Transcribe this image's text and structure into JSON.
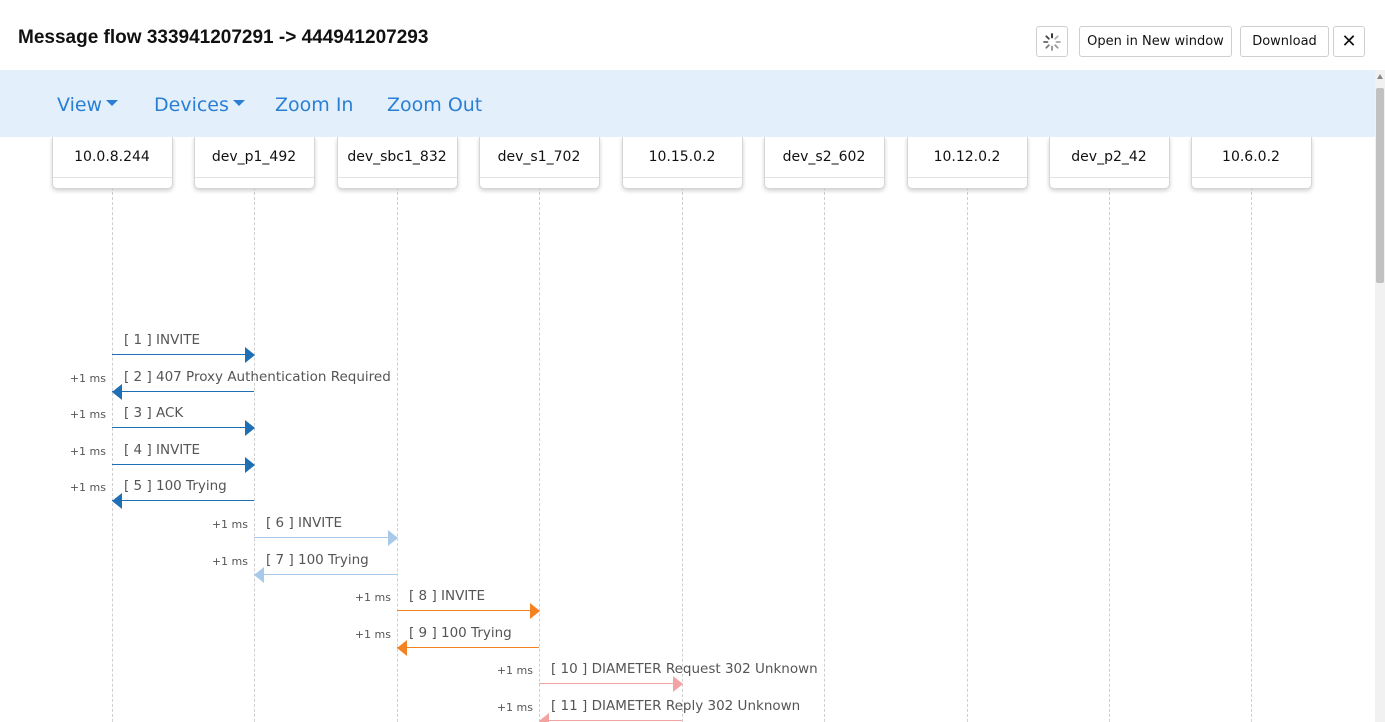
{
  "header": {
    "title": "Message flow 333941207291 -> 444941207293",
    "open_label": "Open in New window",
    "download_label": "Download",
    "close_glyph": "✕",
    "spinner_icon": "loading-spinner-icon"
  },
  "nav": {
    "view_label": "View",
    "devices_label": "Devices",
    "zoom_in_label": "Zoom In",
    "zoom_out_label": "Zoom Out"
  },
  "devices": [
    "10.0.8.244",
    "dev_p1_492",
    "dev_sbc1_832",
    "dev_s1_702",
    "10.15.0.2",
    "dev_s2_602",
    "10.12.0.2",
    "dev_p2_42",
    "10.6.0.2"
  ],
  "colors": {
    "dark_blue": "#1f6fb4",
    "light_blue": "#a9c9ea",
    "orange": "#f58220",
    "pink": "#f4a3a3",
    "link": "#2a7fd4",
    "nav_bg": "#e3f0fb"
  },
  "messages": [
    {
      "label": "[ 1 ] INVITE",
      "delta": "",
      "from": 0,
      "to": 1,
      "color": "dark_blue"
    },
    {
      "label": "[ 2 ] 407 Proxy Authentication Required",
      "delta": "+1 ms",
      "from": 1,
      "to": 0,
      "color": "dark_blue"
    },
    {
      "label": "[ 3 ] ACK",
      "delta": "+1 ms",
      "from": 0,
      "to": 1,
      "color": "dark_blue"
    },
    {
      "label": "[ 4 ] INVITE",
      "delta": "+1 ms",
      "from": 0,
      "to": 1,
      "color": "dark_blue"
    },
    {
      "label": "[ 5 ] 100 Trying",
      "delta": "+1 ms",
      "from": 1,
      "to": 0,
      "color": "dark_blue"
    },
    {
      "label": "[ 6 ] INVITE",
      "delta": "+1 ms",
      "from": 1,
      "to": 2,
      "color": "light_blue"
    },
    {
      "label": "[ 7 ] 100 Trying",
      "delta": "+1 ms",
      "from": 2,
      "to": 1,
      "color": "light_blue"
    },
    {
      "label": "[ 8 ] INVITE",
      "delta": "+1 ms",
      "from": 2,
      "to": 3,
      "color": "orange"
    },
    {
      "label": "[ 9 ] 100 Trying",
      "delta": "+1 ms",
      "from": 3,
      "to": 2,
      "color": "orange"
    },
    {
      "label": "[ 10 ] DIAMETER Request 302 Unknown",
      "delta": "+1 ms",
      "from": 3,
      "to": 4,
      "color": "pink"
    },
    {
      "label": "[ 11 ] DIAMETER Reply 302 Unknown",
      "delta": "+1 ms",
      "from": 4,
      "to": 3,
      "color": "pink"
    }
  ]
}
